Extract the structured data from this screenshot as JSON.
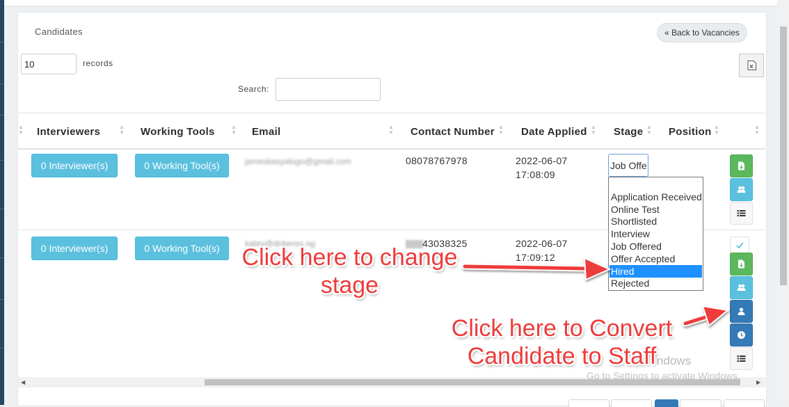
{
  "panel": {
    "title": "Candidates",
    "back_label": "« Back to Vacancies"
  },
  "controls": {
    "records_value": "10",
    "records_label": "records",
    "search_label": "Search:",
    "search_value": ""
  },
  "table": {
    "headers": {
      "interviewers": "Interviewers",
      "tools": "Working Tools",
      "email": "Email",
      "contact": "Contact Number",
      "date": "Date Applied",
      "stage": "Stage",
      "position": "Position"
    },
    "rows": [
      {
        "interviewers_btn": "0 Interviewer(s)",
        "tools_btn": "0 Working Tool(s)",
        "email": "jameskasyalugo@gmail.com",
        "contact": "08078767978",
        "date": "2022-06-07",
        "time": "17:08:09",
        "stage_value": "Job Offe"
      },
      {
        "interviewers_btn": "0 Interviewer(s)",
        "tools_btn": "0 Working Tool(s)",
        "email": "katey@dnberes.ng",
        "contact": "43038325",
        "date": "2022-06-07",
        "time": "17:09:12"
      }
    ]
  },
  "stage_options": [
    "Application Received",
    "Online Test",
    "Shortlisted",
    "Interview",
    "Job Offered",
    "Offer Accepted",
    "Hired",
    "Rejected"
  ],
  "stage_selected": "Hired",
  "annotations": {
    "change_stage_line1": "Click here to change",
    "change_stage_line2": "stage",
    "convert_line1": "Click here to Convert",
    "convert_line2": "Candidate  to Staff"
  },
  "watermark": {
    "line1": "ndows",
    "line2": "Go to Settings to activate Windows."
  },
  "colors": {
    "info": "#5bc0de",
    "success": "#5cb85c",
    "primary": "#337ab7",
    "annotation": "#ee3b3b",
    "selected": "#1e90ff"
  },
  "icons": [
    "file-download-icon",
    "users-icon",
    "list-icon",
    "check-icon",
    "user-icon",
    "clock-icon",
    "excel-icon"
  ]
}
